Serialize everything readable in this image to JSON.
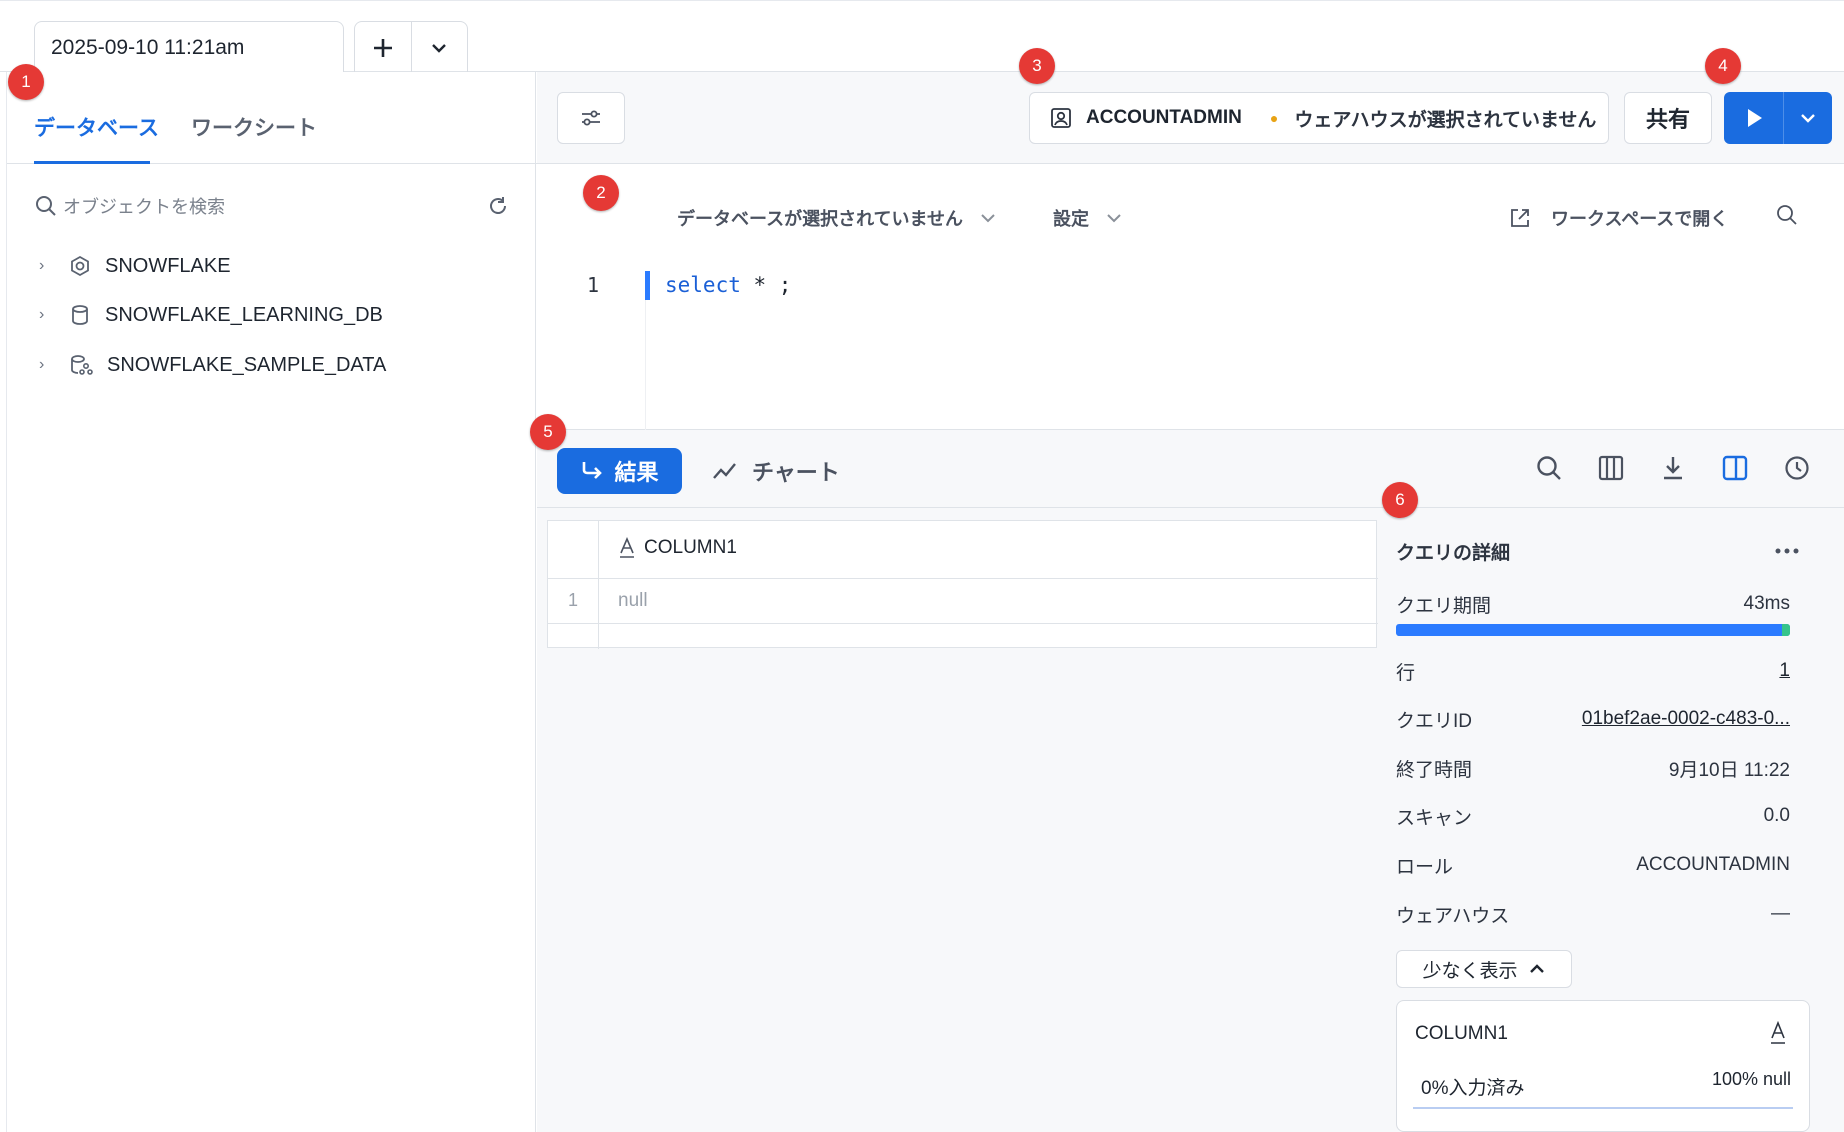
{
  "tab": {
    "title": "2025-09-10 11:21am",
    "add_label": "+",
    "more_label": "⌄"
  },
  "left": {
    "tabs": [
      "データベース",
      "ワークシート"
    ],
    "search_placeholder": "オブジェクトを検索",
    "tree": [
      {
        "label": "SNOWFLAKE",
        "icon": "hexagon-icon"
      },
      {
        "label": "SNOWFLAKE_LEARNING_DB",
        "icon": "database-icon"
      },
      {
        "label": "SNOWFLAKE_SAMPLE_DATA",
        "icon": "shared-database-icon"
      }
    ]
  },
  "toolbar": {
    "role": "ACCOUNTADMIN",
    "warehouse": "ウェアハウスが選択されていません",
    "share_label": "共有"
  },
  "editor": {
    "database_dropdown": "データベースが選択されていません",
    "settings_dropdown": "設定",
    "open_workspace": "ワークスペースで開く",
    "line_number": "1",
    "code_keyword": "select",
    "code_rest": " * ;"
  },
  "results": {
    "results_label": "結果",
    "chart_label": "チャート",
    "column_header": "COLUMN1",
    "rows": [
      {
        "num": "1",
        "value": "null"
      }
    ]
  },
  "details": {
    "title": "クエリの詳細",
    "duration_label": "クエリ期間",
    "duration_value": "43ms",
    "rows_label": "行",
    "rows_value": "1",
    "query_id_label": "クエリID",
    "query_id_value": "01bef2ae-0002-c483-0...",
    "end_time_label": "終了時間",
    "end_time_value": "9月10日 11:22",
    "scan_label": "スキャン",
    "scan_value": "0.0",
    "role_label": "ロール",
    "role_value": "ACCOUNTADMIN",
    "warehouse_label": "ウェアハウス",
    "warehouse_value": "—",
    "show_less": "少なく表示",
    "column_card": {
      "name": "COLUMN1",
      "filled": "0%入力済み",
      "null_pct": "100% null"
    }
  },
  "badges": [
    "1",
    "2",
    "3",
    "4",
    "5",
    "6"
  ],
  "colors": {
    "accent": "#1a6ce0",
    "badge": "#e53935",
    "warning_dot": "#e8a315",
    "progress_tail": "#35c48b"
  }
}
